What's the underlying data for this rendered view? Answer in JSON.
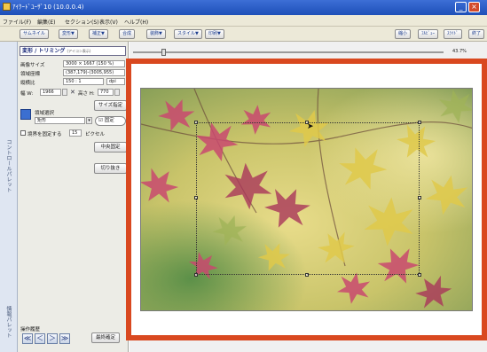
{
  "window": {
    "title": "ｱｲｸｰﾄﾞﾕｰｻﾞ10 (10.0.0.4)",
    "controls": [
      "_",
      "□",
      "×"
    ]
  },
  "menu": [
    "ファイル(F)",
    "編集(E)",
    "セクション(S)",
    "表示(V)",
    "ヘルプ(H)"
  ],
  "toolbar": {
    "buttons": [
      "サムネイル",
      "変形▼",
      "補正▼",
      "合成",
      "装飾▼",
      "スタイル▼",
      "印刷▼"
    ],
    "right_buttons": [
      "縮小",
      "ﾌﾙﾋﾞｭｰ",
      "ｽﾗｲﾄﾞ",
      "終了"
    ]
  },
  "panel": {
    "section_title": "変形 / トリミング",
    "section_sub": "(アイコン表示)",
    "image_size_label": "画像サイズ",
    "image_size_value": "3000 × 1667 (150 %)",
    "area_coords_label": "領域座標",
    "area_coords_value": "(387,179)-(3005,955)",
    "ratio_label": "縦横比",
    "ratio_value": "150 : 1",
    "ratio_unit": "dpi",
    "width_label": "幅 W:",
    "width_value": "1966",
    "height_label": "高さ H:",
    "height_value": "770",
    "size_button": "サイズ指定",
    "region_label": "領域選択",
    "region_value": "矩形",
    "fix_label": "固定",
    "expand_label": "境界を固定する",
    "expand_value": "15",
    "pixel_label": "ピクセル",
    "center_button": "中央固定",
    "crop_button": "切り抜き",
    "side_label_top": "コントロールパレット",
    "side_label_bottom": "情報パレット",
    "history_label": "操作履歴",
    "nav_buttons": [
      "≪",
      "＜",
      "＞",
      "≫"
    ],
    "apply_button": "最終確定"
  },
  "canvas": {
    "zoom": "43.7%"
  },
  "colors": {
    "frame": "#d9481f",
    "titlebar": "#1d4fb8",
    "panel": "#ecece6"
  }
}
